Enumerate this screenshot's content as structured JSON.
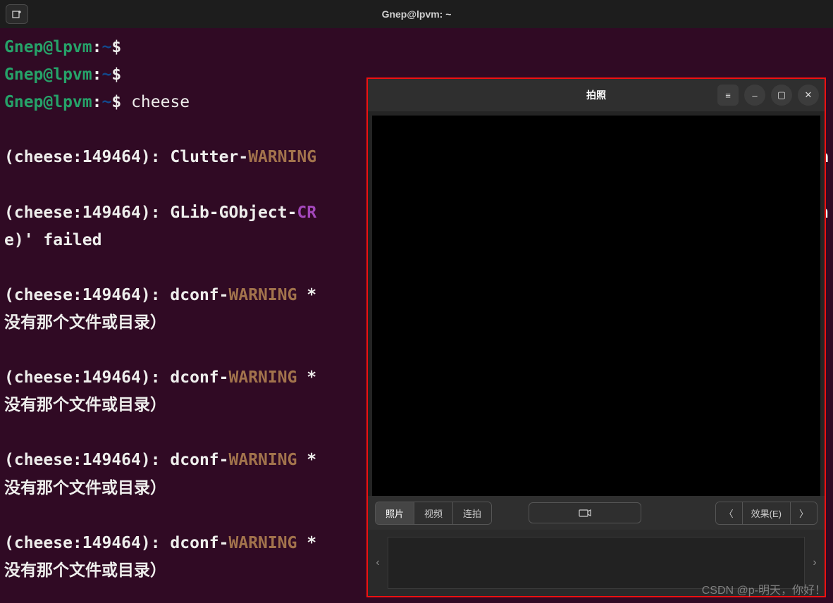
{
  "titlebar": {
    "title": "Gnep@lpvm: ~"
  },
  "terminal": {
    "prompt_user": "Gnep@lpvm",
    "prompt_colon": ":",
    "prompt_path": "~",
    "prompt_dollar": "$",
    "cmd_cheese": "cheese",
    "lines": {
      "l1a": "(cheese:149464): Clutter-",
      "l1warn": "WARNING",
      "l1b_right": "a",
      "l2a": "(cheese:149464): GLib-GObject-",
      "l2crit": "CR",
      "l2b_right": "n",
      "l3": "e)' failed",
      "l4a": "(cheese:149464): dconf-",
      "l4warn": "WARNING",
      "l4b": " *",
      "l5": "没有那个文件或目录）",
      "l6a": "(cheese:149464): dconf-",
      "l6warn": "WARNING",
      "l6b": " *",
      "l7": "没有那个文件或目录）",
      "l8a": "(cheese:149464): dconf-",
      "l8warn": "WARNING",
      "l8b": " *",
      "l9": "没有那个文件或目录）",
      "l10a": "(cheese:149464): dconf-",
      "l10warn": "WARNING",
      "l10b": " *",
      "l11": "没有那个文件或目录）"
    }
  },
  "cheese": {
    "title": "拍照",
    "menu_icon": "≡",
    "minimize_icon": "–",
    "maximize_icon": "▢",
    "close_icon": "✕",
    "modes": {
      "photo": "照片",
      "video": "视频",
      "burst": "连拍"
    },
    "capture_icon": "📷",
    "effects_prev": "〈",
    "effects_label": "效果(E)",
    "effects_next": "〉",
    "thumb_prev": "‹",
    "thumb_next": "›"
  },
  "watermark": "CSDN @p-明天，你好！"
}
